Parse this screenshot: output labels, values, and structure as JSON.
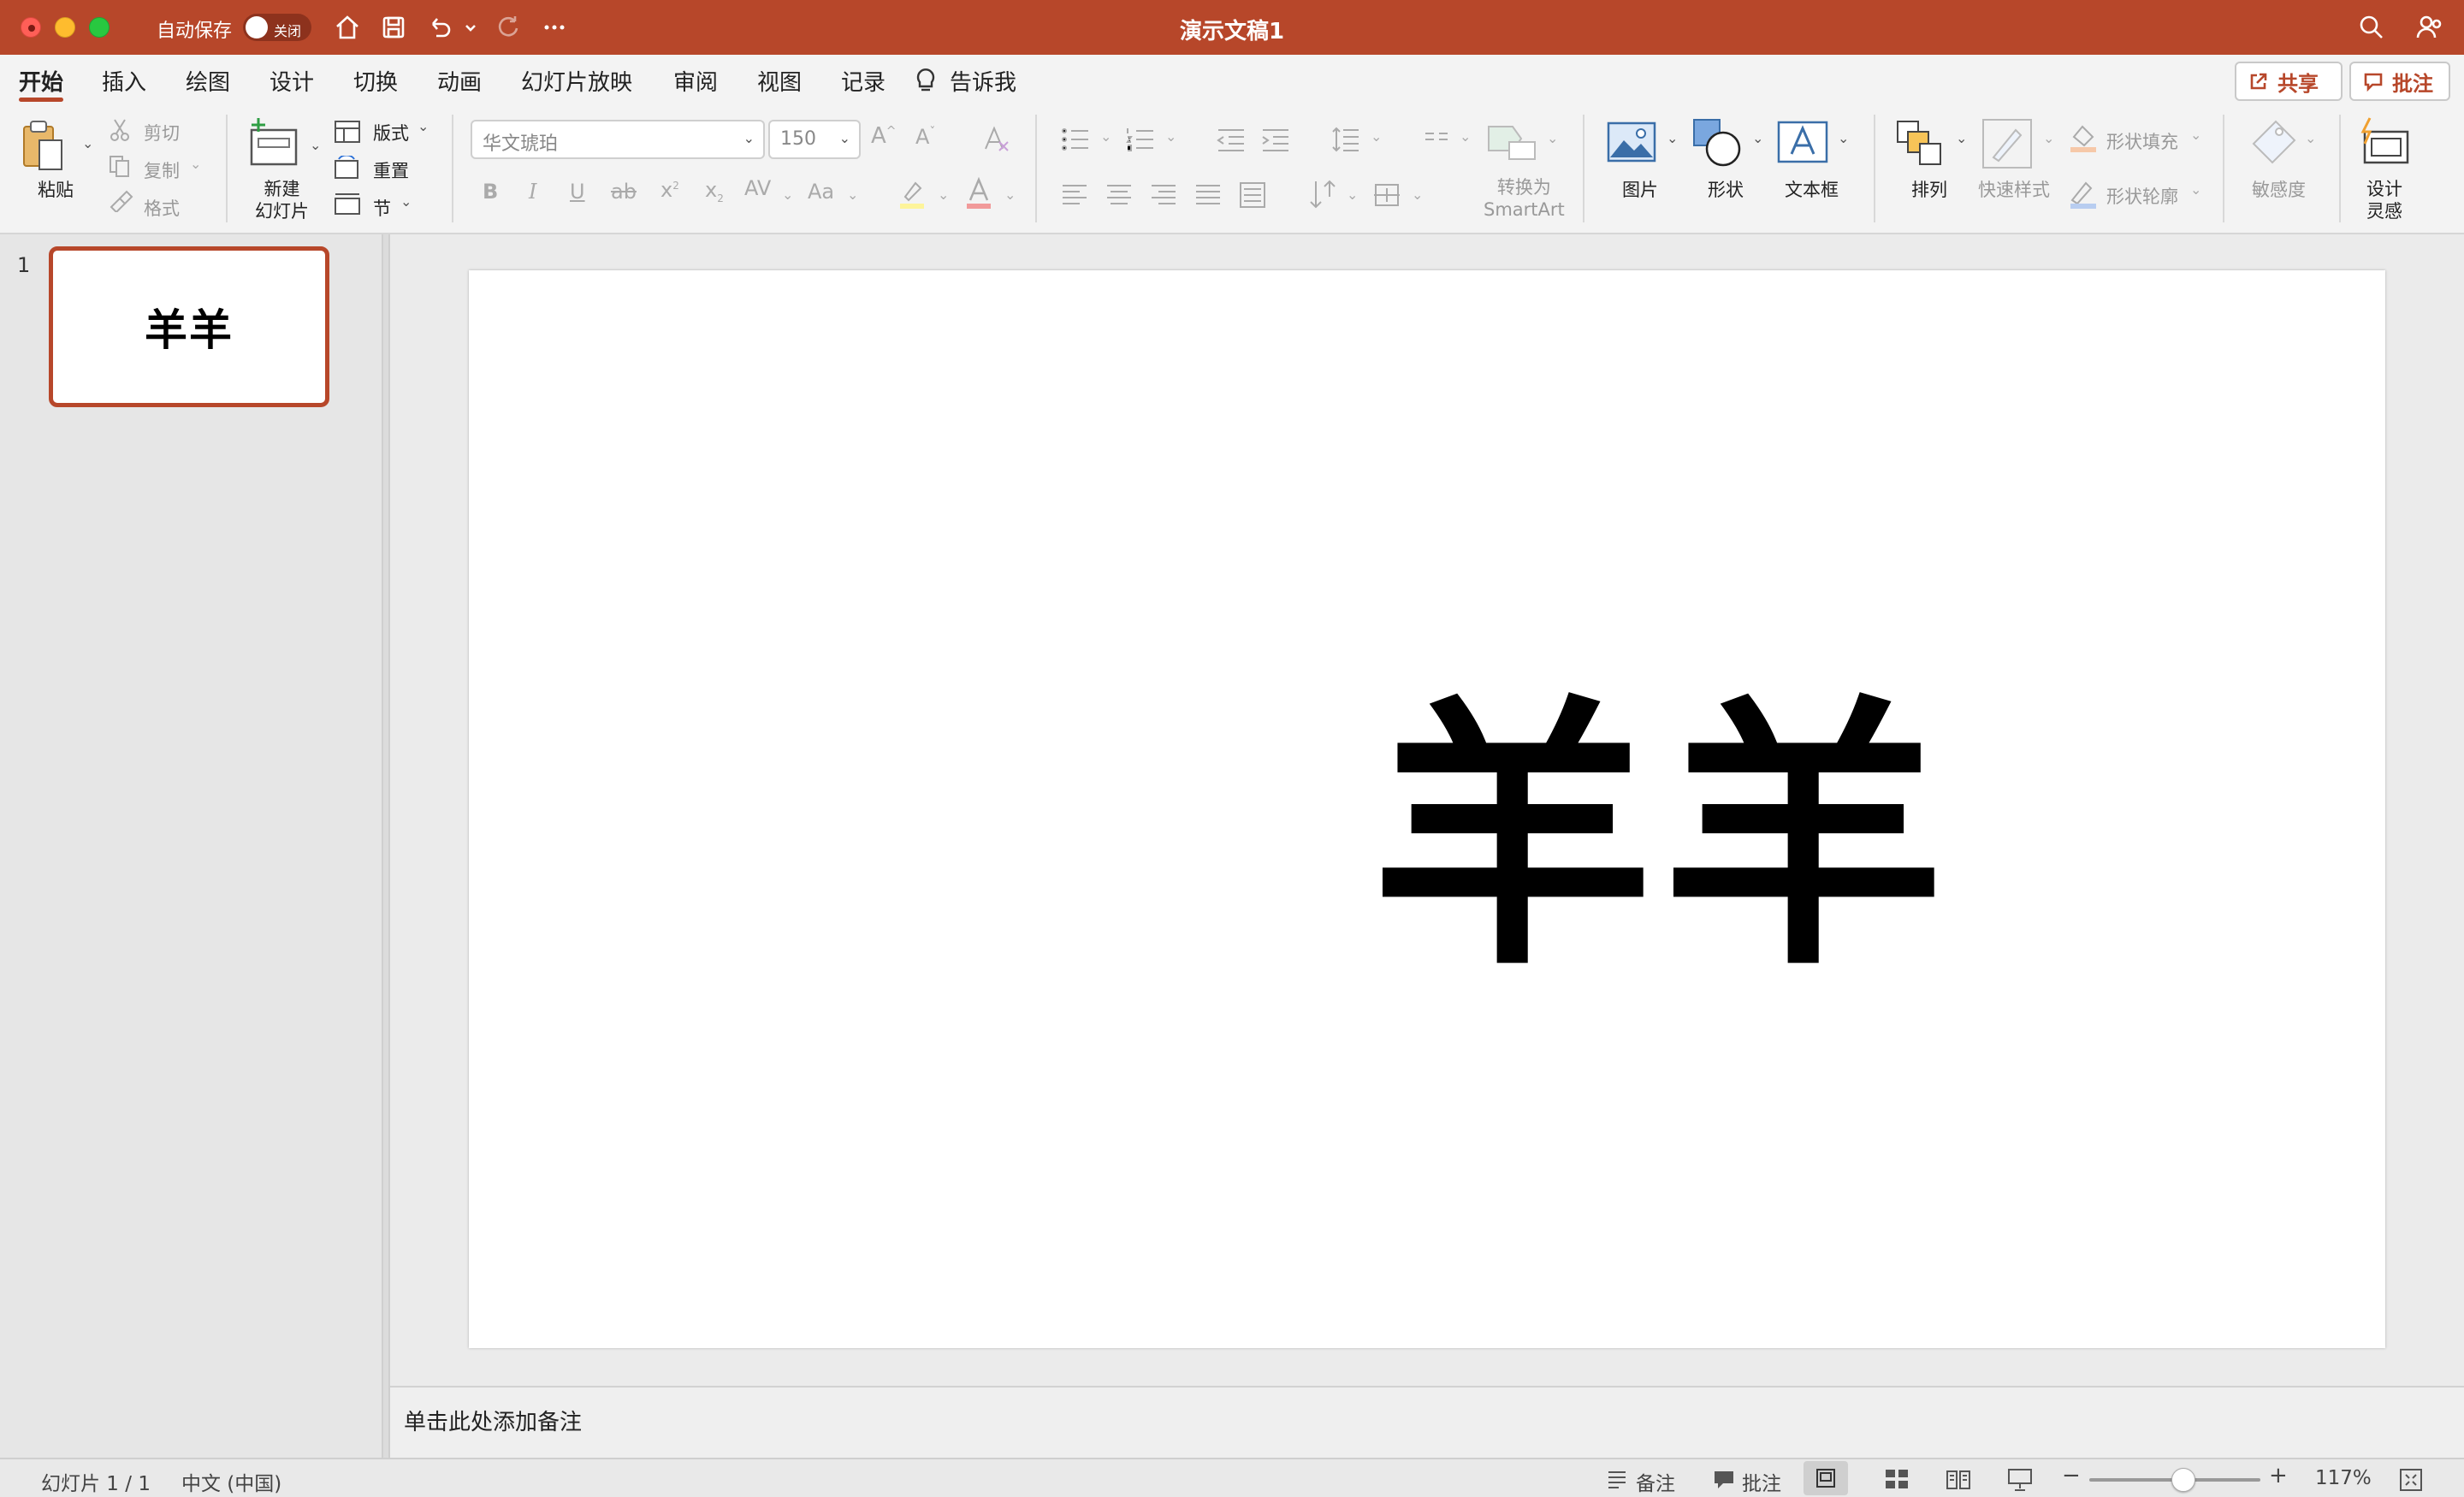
{
  "window": {
    "title": "演示文稿1",
    "autosave_label": "自动保存",
    "autosave_state": "关闭"
  },
  "tabs": [
    "开始",
    "插入",
    "绘图",
    "设计",
    "切换",
    "动画",
    "幻灯片放映",
    "审阅",
    "视图",
    "记录"
  ],
  "active_tab": "开始",
  "tell_me": "告诉我",
  "header_buttons": {
    "share": "共享",
    "comments": "批注"
  },
  "ribbon": {
    "clipboard": {
      "paste": "粘贴",
      "cut": "剪切",
      "copy": "复制",
      "format": "格式"
    },
    "slides": {
      "new_slide": "新建\n幻灯片",
      "layout": "版式",
      "reset": "重置",
      "section": "节"
    },
    "font": {
      "font_name": "华文琥珀",
      "font_size": "150"
    },
    "paragraph": {
      "smartart": "转换为\nSmartArt"
    },
    "insert": {
      "picture": "图片",
      "shape": "形状",
      "textbox": "文本框"
    },
    "drawing": {
      "arrange": "排列",
      "quick_styles": "快速样式",
      "shape_fill": "形状填充",
      "shape_outline": "形状轮廓"
    },
    "sensitivity": "敏感度",
    "designer": "设计\n灵感"
  },
  "slides_panel": {
    "slide_number": "1",
    "thumbnail_text": "羊羊"
  },
  "slide": {
    "title_text": "羊羊"
  },
  "notes": {
    "placeholder": "单击此处添加备注"
  },
  "statusbar": {
    "slide_counter": "幻灯片 1 / 1",
    "language": "中文 (中国)",
    "notes_btn": "备注",
    "comments_btn": "批注",
    "zoom_level": "117%",
    "zoom_fraction": 0.55
  },
  "colors": {
    "accent": "#b7472a",
    "traffic_red": "#ff5f57",
    "traffic_yellow": "#febc2e",
    "traffic_green": "#28c840"
  }
}
